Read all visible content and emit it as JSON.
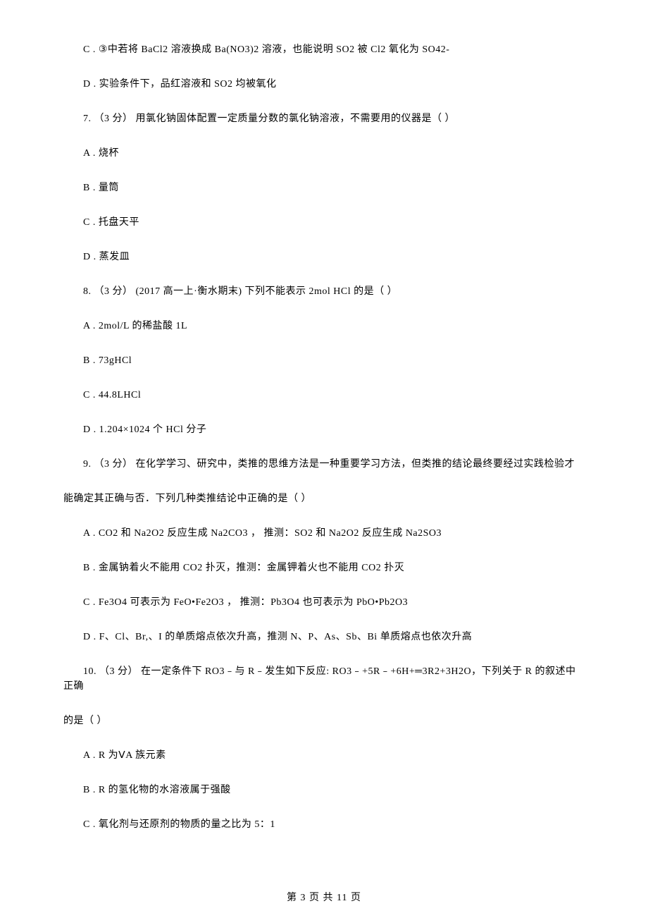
{
  "blocks": [
    {
      "type": "para",
      "text": "C . ③中若将 BaCl2 溶液换成 Ba(NO3)2 溶液，也能说明 SO2 被 Cl2 氧化为 SO42-"
    },
    {
      "type": "para",
      "text": "D . 实验条件下，品红溶液和 SO2 均被氧化"
    },
    {
      "type": "para",
      "text": "7. （3 分）  用氯化钠固体配置一定质量分数的氯化钠溶液，不需要用的仪器是（     ）"
    },
    {
      "type": "para",
      "text": "A . 烧杯"
    },
    {
      "type": "para",
      "text": "B . 量筒"
    },
    {
      "type": "para",
      "text": "C . 托盘天平"
    },
    {
      "type": "para",
      "text": "D . 蒸发皿"
    },
    {
      "type": "para",
      "text": "8. （3 分） (2017 高一上·衡水期末) 下列不能表示 2mol HCl 的是（     ）"
    },
    {
      "type": "para",
      "text": "A . 2mol/L 的稀盐酸 1L"
    },
    {
      "type": "para",
      "text": "B . 73gHCl"
    },
    {
      "type": "para",
      "text": "C . 44.8LHCl"
    },
    {
      "type": "para",
      "text": "D . 1.204×1024 个 HCl 分子"
    },
    {
      "type": "para",
      "text": "9. （3 分） 在化学学习、研究中，类推的思维方法是一种重要学习方法，但类推的结论最终要经过实践检验才"
    },
    {
      "type": "noindent",
      "text": "能确定其正确与否．下列几种类推结论中正确的是（     ）"
    },
    {
      "type": "para",
      "text": "A . CO2 和 Na2O2 反应生成 Na2CO3 ，  推测：SO2 和 Na2O2 反应生成 Na2SO3"
    },
    {
      "type": "para",
      "text": "B . 金属钠着火不能用 CO2 扑灭，推测：金属钾着火也不能用 CO2 扑灭"
    },
    {
      "type": "para",
      "text": "C . Fe3O4 可表示为 FeO•Fe2O3 ，  推测：Pb3O4 也可表示为 PbO•Pb2O3"
    },
    {
      "type": "para",
      "text": "D . F、Cl、Br,、I 的单质熔点依次升高，推测 N、P、As、Sb、Bi 单质熔点也依次升高"
    },
    {
      "type": "para",
      "text": "10. （3 分） 在一定条件下 RO3﹣与 R﹣发生如下反应: RO3﹣+5R﹣+6H+═3R2+3H2O，下列关于 R 的叙述中正确"
    },
    {
      "type": "noindent",
      "text": "的是（     ）"
    },
    {
      "type": "para",
      "text": "A . R 为ⅤA 族元素"
    },
    {
      "type": "para",
      "text": "B . R 的氢化物的水溶液属于强酸"
    },
    {
      "type": "para",
      "text": "C . 氧化剂与还原剂的物质的量之比为 5：1"
    }
  ],
  "footer": "第 3 页 共 11 页"
}
